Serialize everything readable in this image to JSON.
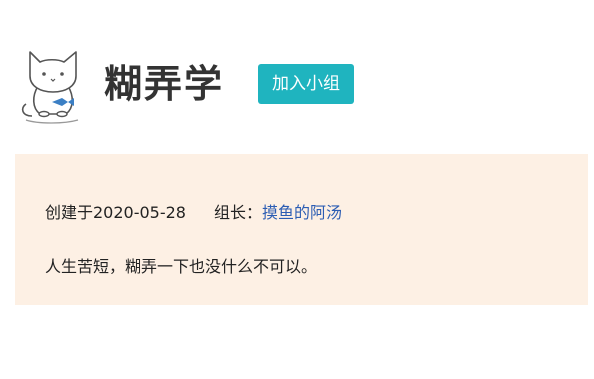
{
  "group": {
    "name": "糊弄学",
    "join_label": "加入小组",
    "avatar_icon": "cat-avatar-icon"
  },
  "info": {
    "created_text": "创建于2020-05-28",
    "leader_label": "组长：",
    "leader_name": "摸鱼的阿汤",
    "description": "人生苦短，糊弄一下也没什么不可以。"
  },
  "colors": {
    "button_bg": "#1fb4bf",
    "panel_bg": "#fdf0e4",
    "link": "#2c5db3"
  }
}
